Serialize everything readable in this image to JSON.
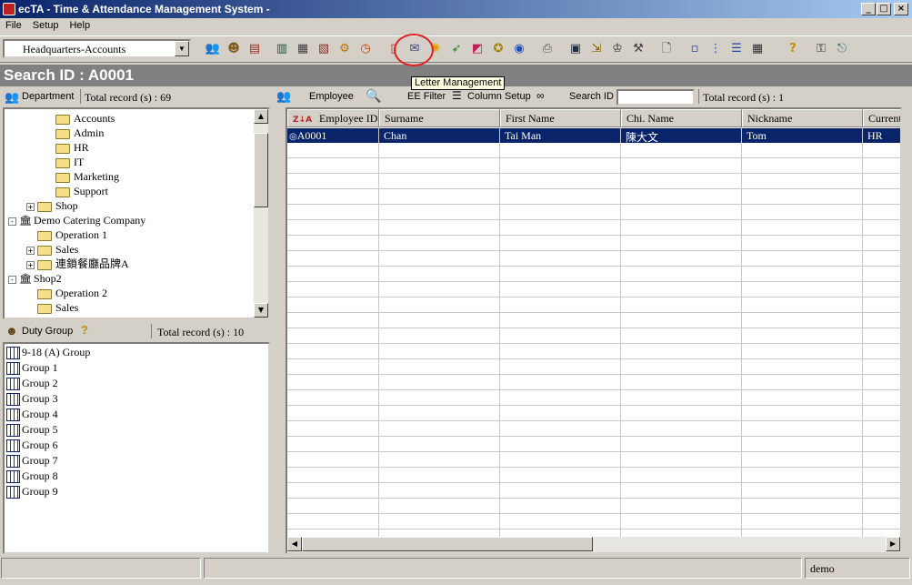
{
  "window": {
    "title": "ecTA - Time & Attendance Management System -",
    "minimize": "_",
    "maximize": "□",
    "close": "×"
  },
  "menu": {
    "items": [
      "File",
      "Setup",
      "Help"
    ]
  },
  "toolbar": {
    "company_select": "Headquarters-Accounts",
    "tooltip": "Letter Management",
    "icons": [
      "group-icon",
      "person-icon",
      "shop-icon",
      "book-icon",
      "report-icon",
      "calendar-icon",
      "gear-icon",
      "clock-icon",
      "door-icon",
      "letter-icon",
      "sun-icon",
      "runner-icon",
      "chart-icon",
      "award-icon",
      "globe-icon",
      "printer-icon",
      "monitor-icon",
      "import-icon",
      "org-icon",
      "tools-icon",
      "document-icon",
      "list-small-icon",
      "list-tree-icon",
      "list-detail-icon",
      "grid-icon",
      "help-icon",
      "key-icon",
      "exit-icon"
    ]
  },
  "search_title": "Search ID : A0001",
  "department": {
    "label": "Department",
    "total": "Total record (s) : 69",
    "tree": [
      {
        "label": "Accounts",
        "type": "folder",
        "level": 3,
        "toggle": ""
      },
      {
        "label": "Admin",
        "type": "folder",
        "level": 3,
        "toggle": ""
      },
      {
        "label": "HR",
        "type": "folder",
        "level": 3,
        "toggle": ""
      },
      {
        "label": "IT",
        "type": "folder",
        "level": 3,
        "toggle": ""
      },
      {
        "label": "Marketing",
        "type": "folder",
        "level": 3,
        "toggle": ""
      },
      {
        "label": "Support",
        "type": "folder",
        "level": 3,
        "toggle": ""
      },
      {
        "label": "Shop",
        "type": "folder",
        "level": 2,
        "toggle": "+"
      },
      {
        "label": "Demo Catering Company",
        "type": "company",
        "level": 1,
        "toggle": "-"
      },
      {
        "label": "Operation 1",
        "type": "folder",
        "level": 2,
        "toggle": ""
      },
      {
        "label": "Sales",
        "type": "folder",
        "level": 2,
        "toggle": "+"
      },
      {
        "label": "連鎖餐廳品牌A",
        "type": "folder",
        "level": 2,
        "toggle": "+"
      },
      {
        "label": "Shop2",
        "type": "company",
        "level": 1,
        "toggle": "-"
      },
      {
        "label": "Operation 2",
        "type": "folder",
        "level": 2,
        "toggle": ""
      },
      {
        "label": "Sales",
        "type": "folder",
        "level": 2,
        "toggle": ""
      }
    ]
  },
  "duty_group": {
    "label": "Duty Group",
    "total": "Total record (s) : 10",
    "items": [
      "9-18 (A) Group",
      "Group 1",
      "Group 2",
      "Group 3",
      "Group 4",
      "Group 5",
      "Group 6",
      "Group 7",
      "Group 8",
      "Group 9"
    ]
  },
  "employee": {
    "label": "Employee",
    "ee_filter": "EE Filter",
    "column_setup": "Column Setup",
    "search_label": "Search ID",
    "search_value": "",
    "total": "Total record (s) : 1",
    "columns": [
      "Employee ID",
      "Surname",
      "First Name",
      "Chi. Name",
      "Nickname",
      "Current"
    ],
    "sort_glyph": "Z↓A",
    "rows": [
      [
        "A0001",
        "Chan",
        "Tai Man",
        "陳大文",
        "Tom",
        "HR"
      ]
    ]
  },
  "status": {
    "user": "demo"
  }
}
